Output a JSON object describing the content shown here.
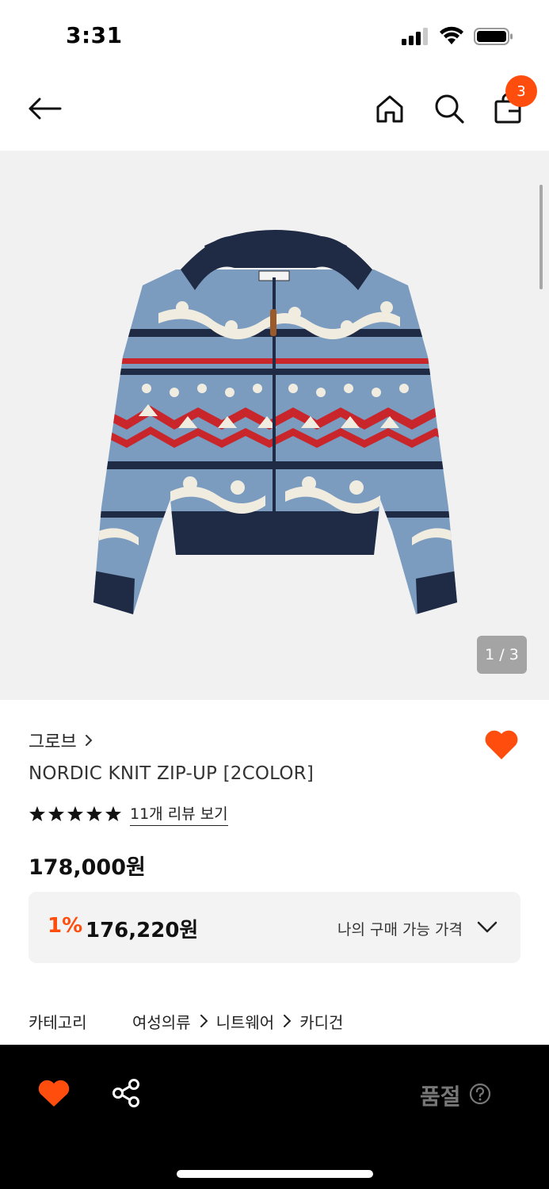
{
  "status_bar": {
    "time": "3:31"
  },
  "nav": {
    "cart_count": "3"
  },
  "product": {
    "image_counter": "1 / 3",
    "brand": "그로브",
    "title": "NORDIC KNIT ZIP-UP [2COLOR]",
    "rating_stars": 5,
    "review_link": "11개 리뷰 보기",
    "price": "178,000원",
    "my_price": {
      "discount_rate": "1%",
      "discount_price": "176,220원",
      "label": "나의 구매 가능 가격"
    },
    "category": {
      "label": "카테고리",
      "path": [
        "여성의류",
        "니트웨어",
        "카디건"
      ]
    }
  },
  "bottom_bar": {
    "status": "품절"
  },
  "colors": {
    "accent": "#ff4d0d",
    "sweater_blue": "#7b9bbf",
    "sweater_navy": "#1f2a44",
    "sweater_red": "#c8262b"
  },
  "icons": [
    "back-arrow-icon",
    "home-icon",
    "search-icon",
    "shopping-bag-icon",
    "heart-icon",
    "star-icon",
    "share-icon",
    "help-icon",
    "chevron-right-icon",
    "chevron-down-icon"
  ]
}
